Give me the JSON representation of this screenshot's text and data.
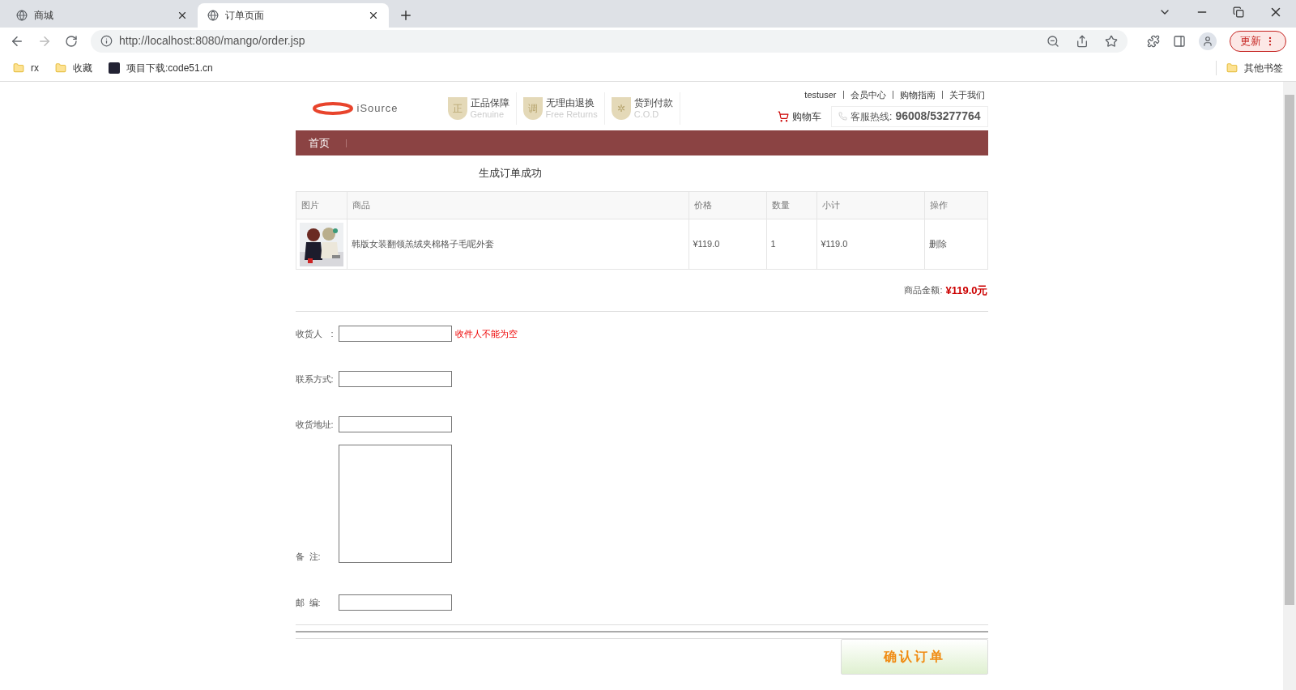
{
  "browser": {
    "tabs": [
      {
        "title": "商城",
        "selected": false
      },
      {
        "title": "订单页面",
        "selected": true
      }
    ],
    "address": "http://localhost:8080/mango/order.jsp",
    "update_button": "更新",
    "bookmarks": [
      {
        "label": "rx",
        "kind": "folder"
      },
      {
        "label": "收藏",
        "kind": "folder"
      },
      {
        "label": "项目下载:code51.cn",
        "kind": "site"
      }
    ],
    "other_bookmarks": "其他书签"
  },
  "header": {
    "logo": "iSource",
    "badges": [
      {
        "title": "正品保障",
        "subtitle": "Genuine",
        "glyph": "正"
      },
      {
        "title": "无理由退换",
        "subtitle": "Free Returns",
        "glyph": "调"
      },
      {
        "title": "货到付款",
        "subtitle": "C.O.D",
        "glyph": "✲"
      }
    ],
    "top_links": [
      "testuser",
      "会员中心",
      "购物指南",
      "关于我们"
    ],
    "cart": "购物车",
    "hotline_label": "客服热线:",
    "hotline": "96008/53277764"
  },
  "nav": [
    "首页"
  ],
  "message": "生成订单成功",
  "table": {
    "columns": [
      "图片",
      "商品",
      "价格",
      "数量",
      "小计",
      "操作"
    ],
    "rows": [
      {
        "name": "韩版女装翻领羔绒夹棉格子毛呢外套",
        "price": "¥119.0",
        "quantity": "1",
        "subtotal": "¥119.0",
        "action": "删除"
      }
    ]
  },
  "total": {
    "label": "商品金额:",
    "value": "¥119.0元"
  },
  "form": {
    "fields": [
      {
        "label": "收货人　:",
        "kind": "input",
        "error": "收件人不能为空"
      },
      {
        "label": "联系方式:",
        "kind": "input"
      },
      {
        "label": "收货地址:",
        "kind": "input"
      },
      {
        "label": "备  注:",
        "kind": "textarea"
      },
      {
        "label": "邮  编:",
        "kind": "input"
      }
    ]
  },
  "submit": "确认订单"
}
